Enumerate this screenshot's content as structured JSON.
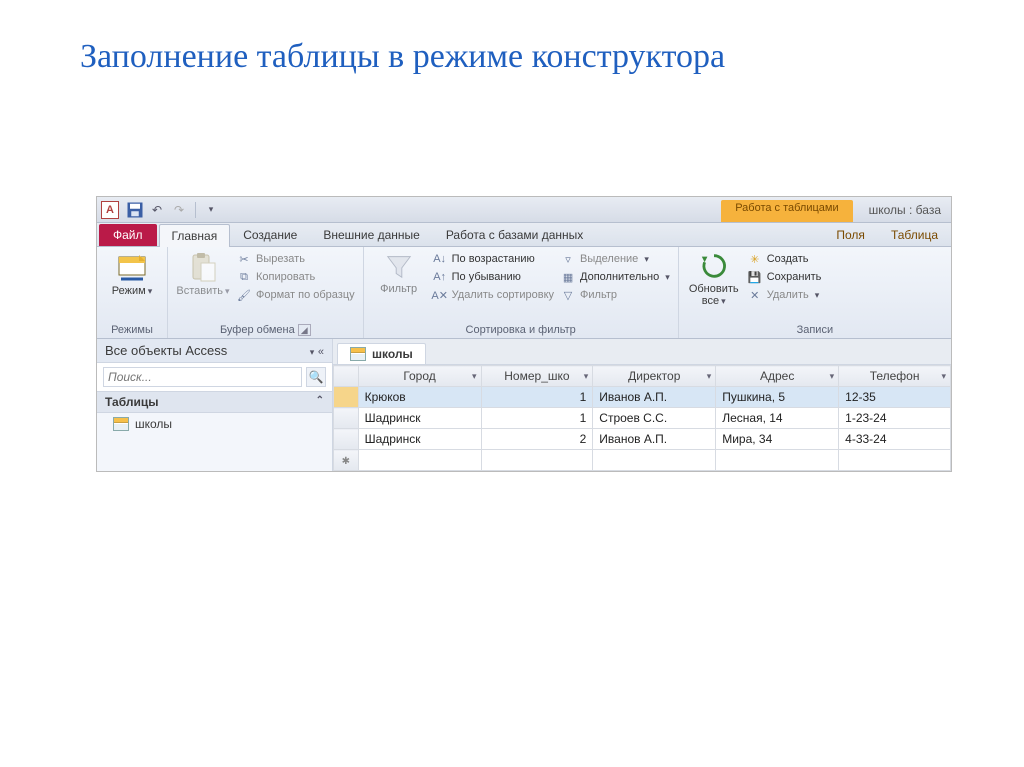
{
  "slide": {
    "title": "Заполнение таблицы в режиме конструктора"
  },
  "titlebar": {
    "context_header": "Работа с таблицами",
    "app_title": "школы : база "
  },
  "tabs": {
    "file": "Файл",
    "home": "Главная",
    "create": "Создание",
    "external": "Внешние данные",
    "dbtools": "Работа с базами данных",
    "fields": "Поля",
    "table": "Таблица"
  },
  "ribbon": {
    "views": {
      "label": "Режимы",
      "view_btn": "Режим"
    },
    "clipboard": {
      "label": "Буфер обмена",
      "paste": "Вставить",
      "cut": "Вырезать",
      "copy": "Копировать",
      "painter": "Формат по образцу"
    },
    "sortfilter": {
      "label": "Сортировка и фильтр",
      "filter": "Фильтр",
      "asc": "По возрастанию",
      "desc": "По убыванию",
      "clear": "Удалить сортировку",
      "selection": "Выделение",
      "advanced": "Дополнительно",
      "toggle": "Фильтр"
    },
    "records": {
      "label": "Записи",
      "refresh": "Обновить\nвсе",
      "new": "Создать",
      "save": "Сохранить",
      "delete": "Удалить"
    }
  },
  "nav": {
    "header": "Все объекты Access",
    "search_placeholder": "Поиск...",
    "section_tables": "Таблицы",
    "item_schools": "школы"
  },
  "doc": {
    "tab": "школы"
  },
  "table": {
    "columns": [
      "Город",
      "Номер_шко",
      "Директор",
      "Адрес",
      "Телефон"
    ],
    "rows": [
      {
        "city": "Крюков",
        "num": "1",
        "director": "Иванов А.П.",
        "addr": "Пушкина, 5",
        "phone": "12-35"
      },
      {
        "city": "Шадринск",
        "num": "1",
        "director": "Строев С.С.",
        "addr": "Лесная, 14",
        "phone": "1-23-24"
      },
      {
        "city": "Шадринск",
        "num": "2",
        "director": "Иванов А.П.",
        "addr": "Мира, 34",
        "phone": "4-33-24"
      }
    ]
  }
}
